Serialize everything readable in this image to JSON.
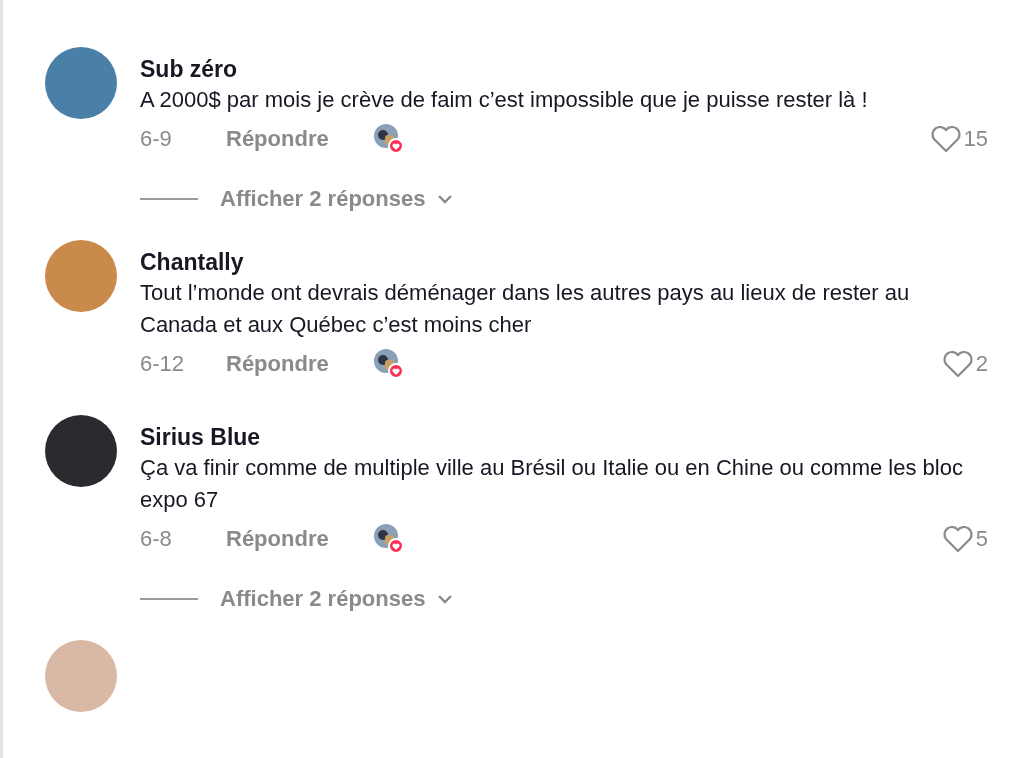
{
  "comments": [
    {
      "author": "Sub zéro",
      "text": "A 2000$ par mois je crève de faim c’est impossible que je puisse rester là !",
      "date": "6-9",
      "reply_label": "Répondre",
      "creator_liked": true,
      "liked": false,
      "likes": "15",
      "view_replies": "Afficher 2 réponses"
    },
    {
      "author": "Chantally",
      "text": "Tout l’monde ont devrais déménager dans les autres pays au lieux de rester au Canada et aux Québec c’est moins cher",
      "date": "6-12",
      "reply_label": "Répondre",
      "creator_liked": true,
      "liked": false,
      "likes": "2"
    },
    {
      "author": "Sirius Blue",
      "text": "Ça va finir comme de multiple ville au Brésil ou Italie ou en Chine ou comme les bloc expo 67",
      "date": "6-8",
      "reply_label": "Répondre",
      "creator_liked": true,
      "liked": false,
      "likes": "5",
      "view_replies": "Afficher 2 réponses"
    }
  ]
}
